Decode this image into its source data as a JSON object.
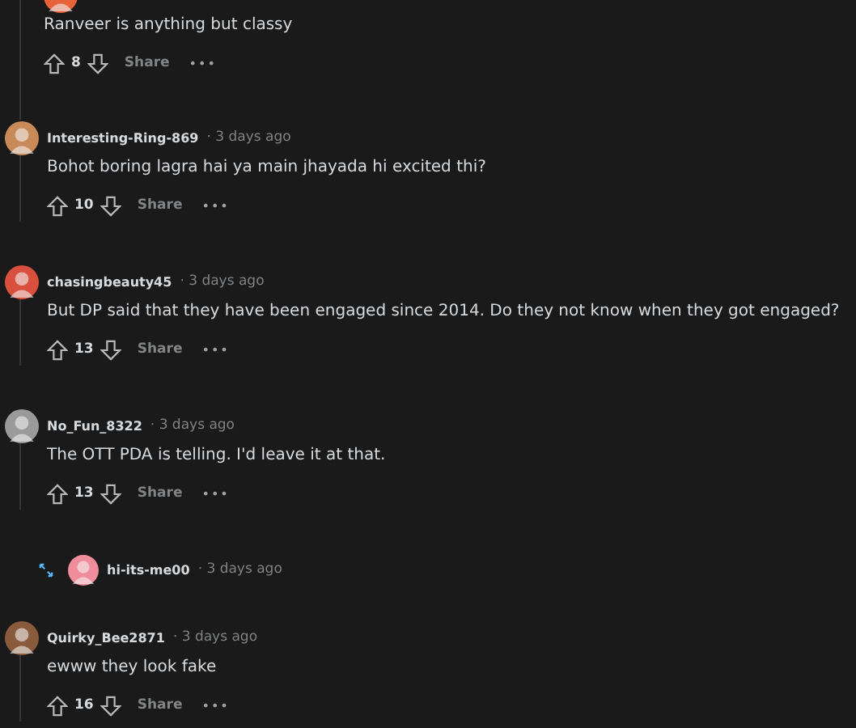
{
  "comments": [
    {
      "nested": true,
      "collapsed": false,
      "color": "#e8623a",
      "body": "Ranveer is anything but classy",
      "votes": "8",
      "share": "Share",
      "more": "•••"
    },
    {
      "nested": false,
      "collapsed": false,
      "color": "#c98a5a",
      "username": "Interesting-Ring-869",
      "time": "· 3 days ago",
      "body": "Bohot boring lagra hai ya main jhayada hi excited thi?",
      "votes": "10",
      "share": "Share",
      "more": "•••"
    },
    {
      "nested": false,
      "collapsed": false,
      "color": "#d9503e",
      "username": "chasingbeauty45",
      "time": "· 3 days ago",
      "body": "But DP said that they have been engaged since 2014. Do they not know when they got engaged?",
      "votes": "13",
      "share": "Share",
      "more": "•••"
    },
    {
      "nested": false,
      "collapsed": false,
      "color": "#9a9a9a",
      "username": "No_Fun_8322",
      "time": "· 3 days ago",
      "body": "The OTT PDA is telling. I'd leave it at that.",
      "votes": "13",
      "share": "Share",
      "more": "•••"
    },
    {
      "nested": false,
      "collapsed": true,
      "color": "#f08d9a",
      "username": "hi-its-me00",
      "time": "· 3 days ago"
    },
    {
      "nested": false,
      "collapsed": false,
      "color": "#8a5a3c",
      "username": "Quirky_Bee2871",
      "time": "· 3 days ago",
      "body": "ewww they look fake",
      "votes": "16",
      "share": "Share",
      "more": "•••"
    }
  ]
}
